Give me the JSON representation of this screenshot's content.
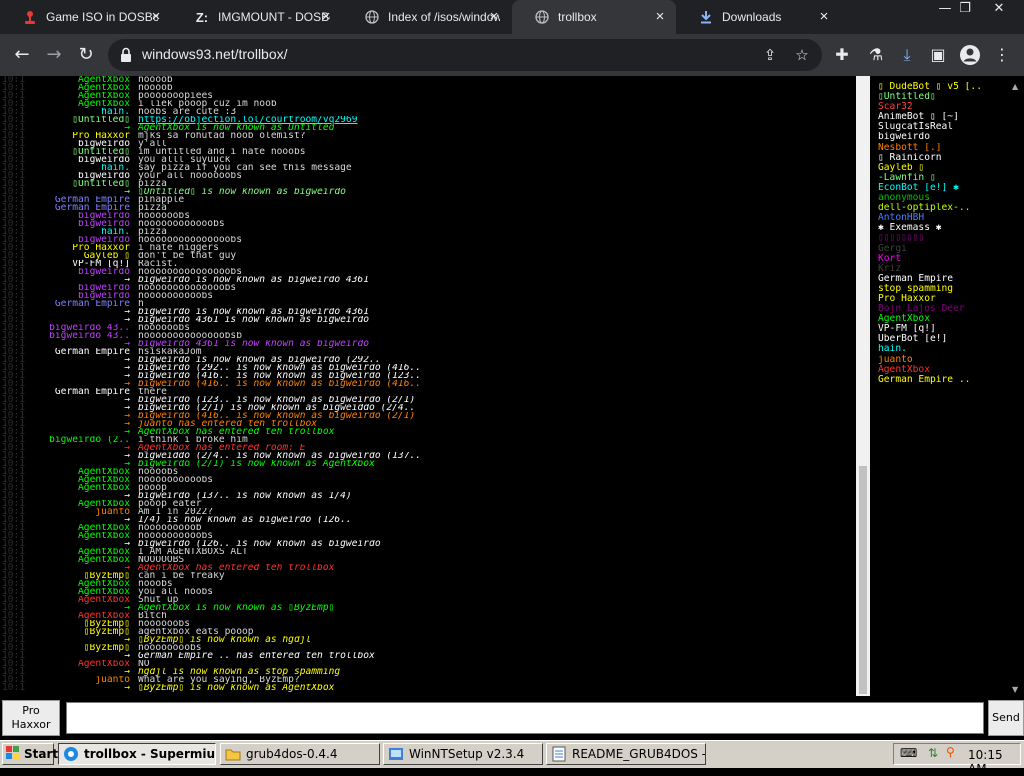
{
  "browser": {
    "tabs": [
      {
        "label": "Game ISO in DOSBox",
        "icon": "red-joystick-icon"
      },
      {
        "label": "IMGMOUNT - DOSBox",
        "icon": "z-letter-icon"
      },
      {
        "label": "Index of /isos/windows",
        "icon": "globe-icon"
      },
      {
        "label": "trollbox",
        "icon": "globe-icon"
      },
      {
        "label": "Downloads",
        "icon": "download-icon"
      }
    ],
    "url": "windows93.net/trollbox/"
  },
  "chat": {
    "messages": [
      {
        "ts": "10:1",
        "nick": "AgentXbox",
        "nick_color": "#00ff00",
        "text": "noooob",
        "kind": "msg"
      },
      {
        "ts": "10:1",
        "nick": "AgentXbox",
        "nick_color": "#00ff00",
        "text": "noooob",
        "kind": "msg"
      },
      {
        "ts": "10:1",
        "nick": "AgentXbox",
        "nick_color": "#00ff00",
        "text": "pooooooopiees",
        "kind": "msg"
      },
      {
        "ts": "10:1",
        "nick": "AgentXbox",
        "nick_color": "#00ff00",
        "text": "i liek pooop cuz im noob",
        "kind": "msg"
      },
      {
        "ts": "10:1",
        "nick": "hain.",
        "nick_color": "#00ffff",
        "text": "noobs are cute :3",
        "kind": "msg"
      },
      {
        "ts": "10:1",
        "nick": "▯Untitled▯",
        "nick_color": "#80ff80",
        "text": "https://objection.lol/courtroom/vq2969",
        "kind": "link"
      },
      {
        "ts": "10:1",
        "nick": "→",
        "nick_color": "#00ff00",
        "text": "AgentXbox is now known as Untitled",
        "kind": "sys"
      },
      {
        "ts": "10:1",
        "nick": "Pro Haxxor",
        "nick_color": "#ffff00",
        "text": "mjks sa rohutad noob olemist?",
        "kind": "msg"
      },
      {
        "ts": "10:1",
        "nick": "bigweirdo",
        "nick_color": "#ffffff",
        "text": "y'all",
        "kind": "msg"
      },
      {
        "ts": "10:1",
        "nick": "▯Untitled▯",
        "nick_color": "#80ff80",
        "text": "im untitled and i hate nooobs",
        "kind": "msg"
      },
      {
        "ts": "10:1",
        "nick": "bigweirdo",
        "nick_color": "#ffffff",
        "text": "you alll suyuuck",
        "kind": "msg"
      },
      {
        "ts": "10:1",
        "nick": "hain.",
        "nick_color": "#00ffff",
        "text": "say pizza if you can see this message",
        "kind": "msg"
      },
      {
        "ts": "10:1",
        "nick": "bigweirdo",
        "nick_color": "#ffffff",
        "text": "your all noooooobs",
        "kind": "msg"
      },
      {
        "ts": "10:1",
        "nick": "▯Untitled▯",
        "nick_color": "#80ff80",
        "text": "pizza",
        "kind": "msg"
      },
      {
        "ts": "10:1",
        "nick": "→",
        "nick_color": "#80ff80",
        "text": "▯Untitled▯ is now known as bigweirdo",
        "kind": "sys"
      },
      {
        "ts": "10:1",
        "nick": "German Empire",
        "nick_color": "#8080ff",
        "text": "pinapple",
        "kind": "msg"
      },
      {
        "ts": "10:1",
        "nick": "German Empire",
        "nick_color": "#8080ff",
        "text": "pizza",
        "kind": "msg"
      },
      {
        "ts": "10:1",
        "nick": "bigweirdo",
        "nick_color": "#c040ff",
        "text": "noooooobs",
        "kind": "msg"
      },
      {
        "ts": "10:1",
        "nick": "bigweirdo",
        "nick_color": "#c040ff",
        "text": "noooooooooooobs",
        "kind": "msg"
      },
      {
        "ts": "10:1",
        "nick": "hain.",
        "nick_color": "#00ffff",
        "text": "pizza",
        "kind": "msg"
      },
      {
        "ts": "10:1",
        "nick": "bigweirdo",
        "nick_color": "#c040ff",
        "text": "nooooooooooooooobs",
        "kind": "msg"
      },
      {
        "ts": "10:1",
        "nick": "Pro Haxxor",
        "nick_color": "#ffff00",
        "text": "i hate niggers",
        "kind": "msg"
      },
      {
        "ts": "10:1",
        "nick": "Gayleb ▯",
        "nick_color": "#ffff00",
        "text": "don't be that guy",
        "kind": "msg"
      },
      {
        "ts": "10:1",
        "nick": "VP-FM [q!]",
        "nick_color": "#ffffff",
        "text": "Racist.",
        "kind": "msg"
      },
      {
        "ts": "10:1",
        "nick": "bigweirdo",
        "nick_color": "#c040ff",
        "text": "nooooooooooooooobs",
        "kind": "msg"
      },
      {
        "ts": "10:1",
        "nick": "→",
        "nick_color": "#ffffff",
        "text": "bigweirdo is now known as bigweirdo_4361",
        "kind": "sys"
      },
      {
        "ts": "10:1",
        "nick": "bigweirdo",
        "nick_color": "#c040ff",
        "text": "noooooooooooooobs",
        "kind": "msg"
      },
      {
        "ts": "10:1",
        "nick": "bigweirdo",
        "nick_color": "#c040ff",
        "text": "noooooooooobs",
        "kind": "msg"
      },
      {
        "ts": "10:1",
        "nick": "German Empire",
        "nick_color": "#8080ff",
        "text": "h",
        "kind": "msg"
      },
      {
        "ts": "10:1",
        "nick": "→",
        "nick_color": "#ffffff",
        "text": "bigweirdo is now known as bigweirdo_4361",
        "kind": "sys"
      },
      {
        "ts": "10:1",
        "nick": "→",
        "nick_color": "#ffffff",
        "text": "bigweirdo_4361 is now known as bigweirdo",
        "kind": "sys"
      },
      {
        "ts": "10:1",
        "nick": "bigweirdo_43..",
        "nick_color": "#c040ff",
        "text": "noooooobs",
        "kind": "msg"
      },
      {
        "ts": "10:1",
        "nick": "bigweirdo_43..",
        "nick_color": "#c040ff",
        "text": "noooooooooooooobsb",
        "kind": "msg"
      },
      {
        "ts": "10:1",
        "nick": "→",
        "nick_color": "#c040ff",
        "text": "bigweirdo_4361 is now known as bigweirdo",
        "kind": "sys"
      },
      {
        "ts": "10:1",
        "nick": "German Empire",
        "nick_color": "#ffffff",
        "text": "hsiskakaJom",
        "kind": "msg"
      },
      {
        "ts": "10:1",
        "nick": "→",
        "nick_color": "#ffffff",
        "text": "bigweirdo is now known as bigweirdo (292..",
        "kind": "sys"
      },
      {
        "ts": "10:1",
        "nick": "→",
        "nick_color": "#ffffff",
        "text": "bigweirdo (292.. is now known as bigweirdo (416..",
        "kind": "sys"
      },
      {
        "ts": "10:1",
        "nick": "→",
        "nick_color": "#ffffff",
        "text": "bigweirdo (416.. is now known as bigweirdo (123..",
        "kind": "sys"
      },
      {
        "ts": "10:1",
        "nick": "→",
        "nick_color": "#ff8000",
        "text": "bigweirdo (416.. is now known as bigweirdo (416..",
        "kind": "sys"
      },
      {
        "ts": "10:1",
        "nick": "German Empire",
        "nick_color": "#ffffff",
        "text": "there",
        "kind": "msg"
      },
      {
        "ts": "10:1",
        "nick": "→",
        "nick_color": "#ffffff",
        "text": "bigweirdo (123.. is now known as bigweirdo (2/1)",
        "kind": "sys"
      },
      {
        "ts": "10:1",
        "nick": "→",
        "nick_color": "#ffffff",
        "text": "bigweirdo (2/1) is now known as bigweiddo (2/4..",
        "kind": "sys"
      },
      {
        "ts": "10:1",
        "nick": "→",
        "nick_color": "#ff8000",
        "text": "bigweirdo (416.. is now known as bigweirdo (2/1)",
        "kind": "sys"
      },
      {
        "ts": "10:1",
        "nick": "→",
        "nick_color": "#ff8000",
        "text": "juanto has entered teh trollbox",
        "kind": "sys"
      },
      {
        "ts": "10:1",
        "nick": "→",
        "nick_color": "#00ff00",
        "text": "AgentXbox has entered teh trollbox",
        "kind": "sys"
      },
      {
        "ts": "10:1",
        "nick": "bigweirdo (2..",
        "nick_color": "#00ff00",
        "text": "i think i broke him",
        "kind": "msg"
      },
      {
        "ts": "10:1",
        "nick": "→",
        "nick_color": "#ff3030",
        "text": "AgentXbox has entered room: E",
        "kind": "sys"
      },
      {
        "ts": "10:1",
        "nick": "→",
        "nick_color": "#ffffff",
        "text": "bigweiddo (2/4.. is now known as bigweirdo (137..",
        "kind": "sys"
      },
      {
        "ts": "10:1",
        "nick": "→",
        "nick_color": "#00ff00",
        "text": "bigweirdo (2/1) is now known as AgentXbox",
        "kind": "sys"
      },
      {
        "ts": "10:1",
        "nick": "AgentXbox",
        "nick_color": "#00ff00",
        "text": "noooobs",
        "kind": "msg"
      },
      {
        "ts": "10:1",
        "nick": "AgentXbox",
        "nick_color": "#00ff00",
        "text": "noooooooooobs",
        "kind": "msg"
      },
      {
        "ts": "10:1",
        "nick": "AgentXbox",
        "nick_color": "#00ff00",
        "text": "pooop",
        "kind": "msg"
      },
      {
        "ts": "10:1",
        "nick": "→",
        "nick_color": "#ffffff",
        "text": "bigweirdo (137.. is now known as 1/4)",
        "kind": "sys"
      },
      {
        "ts": "10:1",
        "nick": "AgentXbox",
        "nick_color": "#00ff00",
        "text": "pooop eater",
        "kind": "msg"
      },
      {
        "ts": "10:1",
        "nick": "juanto",
        "nick_color": "#ff8000",
        "text": "Am I in 2022?",
        "kind": "msg"
      },
      {
        "ts": "10:1",
        "nick": "→",
        "nick_color": "#ffffff",
        "text": "1/4) is now known as bigweirdo (126..",
        "kind": "sys"
      },
      {
        "ts": "10:1",
        "nick": "AgentXbox",
        "nick_color": "#00ff00",
        "text": "nooooooooob",
        "kind": "msg"
      },
      {
        "ts": "10:1",
        "nick": "AgentXbox",
        "nick_color": "#00ff00",
        "text": "noooooooooobs",
        "kind": "msg"
      },
      {
        "ts": "10:1",
        "nick": "→",
        "nick_color": "#ffffff",
        "text": "bigweirdo (126.. is now known as bigweirdo",
        "kind": "sys"
      },
      {
        "ts": "10:1",
        "nick": "AgentXbox",
        "nick_color": "#00ff00",
        "text": "I AM AGENTXBOXS ALT",
        "kind": "msg"
      },
      {
        "ts": "10:1",
        "nick": "AgentXbox",
        "nick_color": "#00ff00",
        "text": "NOOOOOBS",
        "kind": "msg"
      },
      {
        "ts": "10:1",
        "nick": "→",
        "nick_color": "#ff3030",
        "text": "AgentXbox has entered teh trollbox",
        "kind": "sys"
      },
      {
        "ts": "10:1",
        "nick": "▯ByzEmp▯",
        "nick_color": "#ffff00",
        "text": "can i be freaky",
        "kind": "msg"
      },
      {
        "ts": "10:1",
        "nick": "AgentXbox",
        "nick_color": "#00ff00",
        "text": "nooobs",
        "kind": "msg"
      },
      {
        "ts": "10:1",
        "nick": "AgentXbox",
        "nick_color": "#00ff00",
        "text": "you all noobs",
        "kind": "msg"
      },
      {
        "ts": "10:1",
        "nick": "AgentXbox",
        "nick_color": "#ff3030",
        "text": "Shut up",
        "kind": "msg"
      },
      {
        "ts": "10:1",
        "nick": "→",
        "nick_color": "#00ff00",
        "text": "AgentXbox is now known as ▯ByzEmp▯",
        "kind": "sys"
      },
      {
        "ts": "10:1",
        "nick": "AgentXbox",
        "nick_color": "#ff3030",
        "text": "Bitch",
        "kind": "msg"
      },
      {
        "ts": "10:1",
        "nick": "▯ByzEmp▯",
        "nick_color": "#ffff00",
        "text": "noooooobs",
        "kind": "msg"
      },
      {
        "ts": "10:1",
        "nick": "▯ByzEmp▯",
        "nick_color": "#ffff00",
        "text": "agentxbox eats pooop",
        "kind": "msg"
      },
      {
        "ts": "10:1",
        "nick": "→",
        "nick_color": "#ffff00",
        "text": "▯ByzEmp▯ is now known as hgdjl",
        "kind": "sys"
      },
      {
        "ts": "10:1",
        "nick": "▯ByzEmp▯",
        "nick_color": "#ffff00",
        "text": "noooooooobs",
        "kind": "msg"
      },
      {
        "ts": "10:1",
        "nick": "→",
        "nick_color": "#ffffff",
        "text": "German Empire .. has entered teh trollbox",
        "kind": "sys"
      },
      {
        "ts": "10:1",
        "nick": "AgentXbox",
        "nick_color": "#ff3030",
        "text": "NO",
        "kind": "msg"
      },
      {
        "ts": "10:1",
        "nick": "→",
        "nick_color": "#ffff00",
        "text": "hgdjl is now known as stop spamming",
        "kind": "sys"
      },
      {
        "ts": "10:1",
        "nick": "juanto",
        "nick_color": "#ff8000",
        "text": "What are you saying, ByzEmp?",
        "kind": "msg"
      },
      {
        "ts": "10:1",
        "nick": "→",
        "nick_color": "#ffff00",
        "text": "▯ByzEmp▯ is now known as AgentXbox",
        "kind": "sys"
      }
    ],
    "users": [
      {
        "name": "▯ DudeBot ▯ v5 [..",
        "color": "#ffff00"
      },
      {
        "name": "▯Untitled▯",
        "color": "#80ff80"
      },
      {
        "name": "Scar32",
        "color": "#ff4040"
      },
      {
        "name": "AnimeBot ▯ [~]",
        "color": "#ffffff"
      },
      {
        "name": "SlugcatIsReal",
        "color": "#ffffff"
      },
      {
        "name": "bigweirdo",
        "color": "#ffffff"
      },
      {
        "name": "Nesbott [.]",
        "color": "#ff8000"
      },
      {
        "name": "▯ Rainicorn",
        "color": "#ffffff"
      },
      {
        "name": "Gayleb ▯",
        "color": "#ffff00"
      },
      {
        "name": "-Lawnfin ▯",
        "color": "#80ff80"
      },
      {
        "name": "EconBot [e!] ✱",
        "color": "#00ffff"
      },
      {
        "name": "anonymous",
        "color": "#00c000"
      },
      {
        "name": "dell-optiplex-..",
        "color": "#c0ff00"
      },
      {
        "name": "AntonHBH",
        "color": "#4080ff"
      },
      {
        "name": "✱ Exemass ✱",
        "color": "#ffffff"
      },
      {
        "name": "▯▯▯▯▯▯▯▯",
        "color": "#800080"
      },
      {
        "name": "Gergi",
        "color": "#404040"
      },
      {
        "name": "Kort",
        "color": "#ff00ff"
      },
      {
        "name": "Kriz",
        "color": "#404040"
      },
      {
        "name": "German Empire",
        "color": "#ffffff"
      },
      {
        "name": "stop spamming",
        "color": "#ffff00"
      },
      {
        "name": "Pro Haxxor",
        "color": "#ffff00"
      },
      {
        "name": "Bojn Lajos Deer",
        "color": "#800080"
      },
      {
        "name": "AgentXbox",
        "color": "#00ff00"
      },
      {
        "name": "VP-FM [q!]",
        "color": "#ffffff"
      },
      {
        "name": "UberBot [e!]",
        "color": "#ffffff"
      },
      {
        "name": "hain.",
        "color": "#00ffff"
      },
      {
        "name": "juanto",
        "color": "#ff8000"
      },
      {
        "name": "AgentXbox",
        "color": "#ff3030"
      },
      {
        "name": "German Empire ..",
        "color": "#ffff00"
      }
    ],
    "nick_button": "Pro Haxxor",
    "send_label": "Send",
    "input_value": ""
  },
  "taskbar": {
    "start_label": "Start",
    "tasks": [
      {
        "label": "trollbox - Supermium",
        "icon": "browser-icon",
        "active": true
      },
      {
        "label": "grub4dos-0.4.4",
        "icon": "folder-icon",
        "active": false
      },
      {
        "label": "WinNTSetup v2.3.4",
        "icon": "setup-icon",
        "active": false
      },
      {
        "label": "README_GRUB4DOS - ...",
        "icon": "notepad-icon",
        "active": false
      }
    ],
    "clock": "10:15 AM"
  }
}
